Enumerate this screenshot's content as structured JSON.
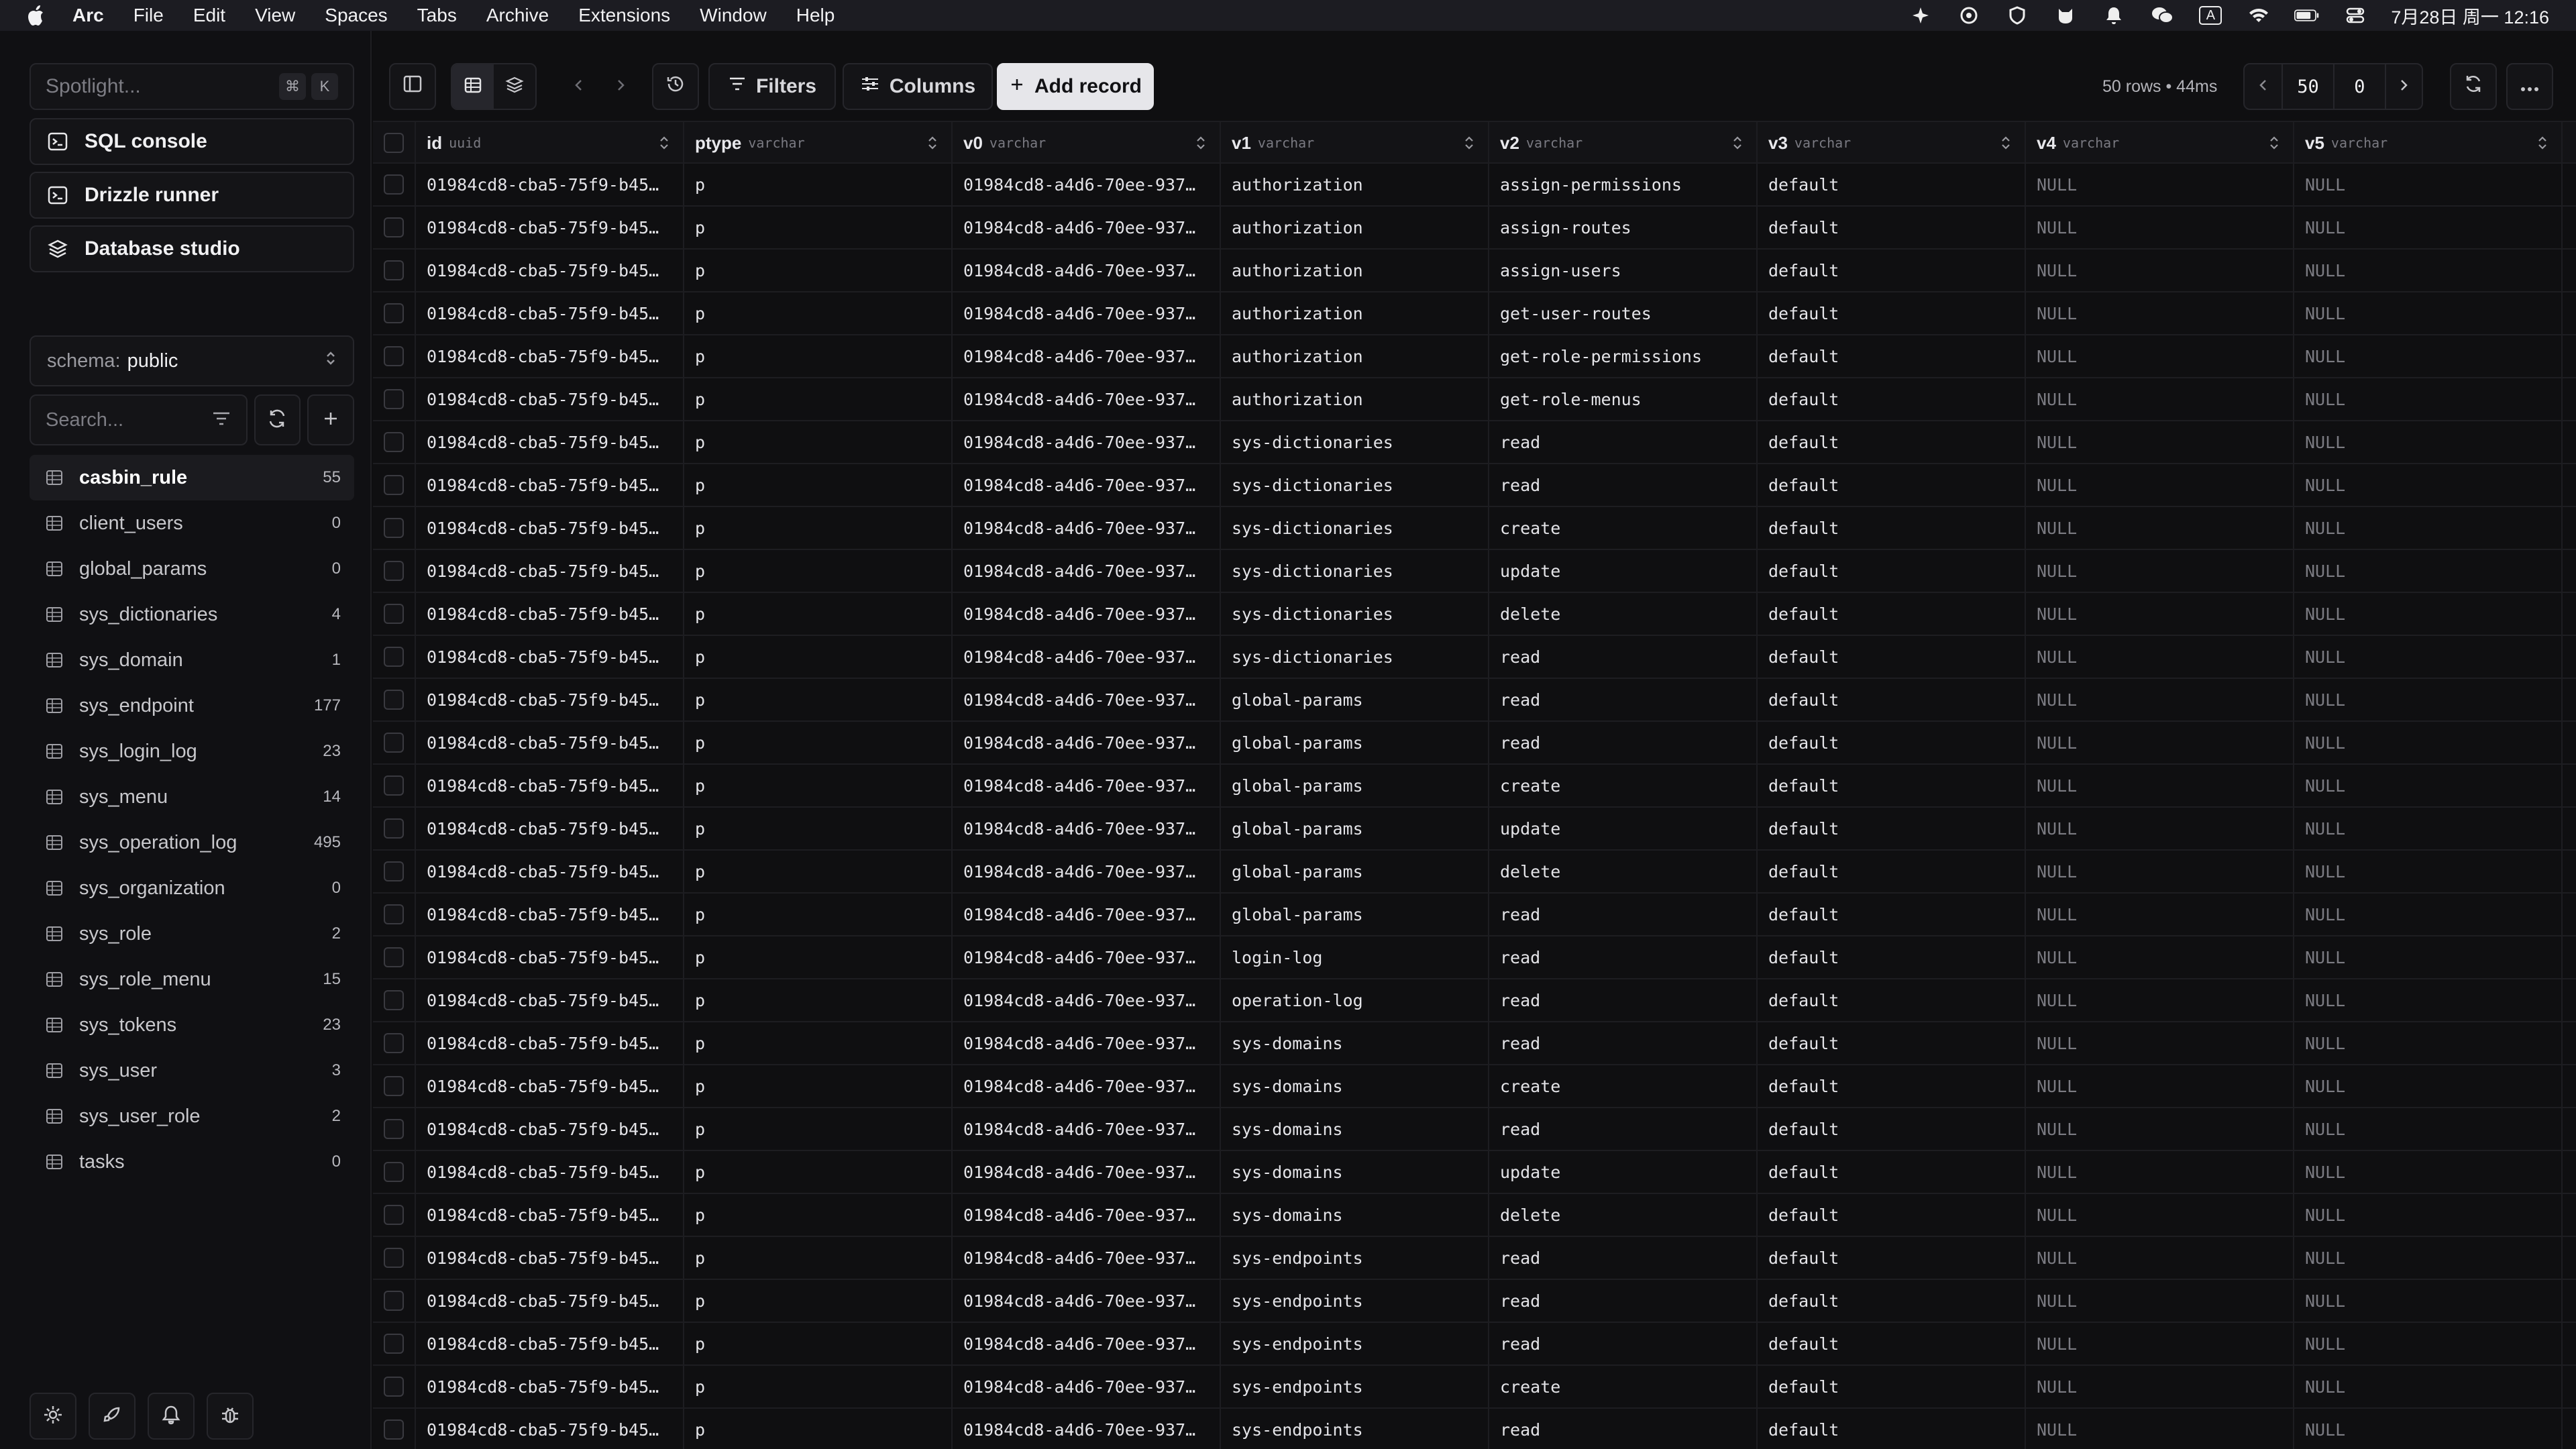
{
  "menubar": {
    "app": "Arc",
    "items": [
      "File",
      "Edit",
      "View",
      "Spaces",
      "Tabs",
      "Archive",
      "Extensions",
      "Window",
      "Help"
    ],
    "clock": "7月28日 周一 12:16",
    "input_indicator": "A"
  },
  "sidebar": {
    "spotlight_placeholder": "Spotlight...",
    "shortcut_cmd": "⌘",
    "shortcut_key": "K",
    "nav": [
      {
        "label": "SQL console",
        "icon": "terminal-icon"
      },
      {
        "label": "Drizzle runner",
        "icon": "terminal-icon"
      },
      {
        "label": "Database studio",
        "icon": "layers-icon"
      }
    ],
    "schema_label": "schema:",
    "schema_value": "public",
    "search_placeholder": "Search...",
    "tables": [
      {
        "name": "casbin_rule",
        "count": "55",
        "active": true
      },
      {
        "name": "client_users",
        "count": "0"
      },
      {
        "name": "global_params",
        "count": "0"
      },
      {
        "name": "sys_dictionaries",
        "count": "4"
      },
      {
        "name": "sys_domain",
        "count": "1"
      },
      {
        "name": "sys_endpoint",
        "count": "177"
      },
      {
        "name": "sys_login_log",
        "count": "23"
      },
      {
        "name": "sys_menu",
        "count": "14"
      },
      {
        "name": "sys_operation_log",
        "count": "495"
      },
      {
        "name": "sys_organization",
        "count": "0"
      },
      {
        "name": "sys_role",
        "count": "2"
      },
      {
        "name": "sys_role_menu",
        "count": "15"
      },
      {
        "name": "sys_tokens",
        "count": "23"
      },
      {
        "name": "sys_user",
        "count": "3"
      },
      {
        "name": "sys_user_role",
        "count": "2"
      },
      {
        "name": "tasks",
        "count": "0"
      }
    ]
  },
  "toolbar": {
    "filters_label": "Filters",
    "columns_label": "Columns",
    "add_record_label": "Add record",
    "rows_info": "50 rows • 44ms",
    "limit": "50",
    "offset": "0"
  },
  "grid": {
    "columns": [
      {
        "name": "id",
        "type": "uuid"
      },
      {
        "name": "ptype",
        "type": "varchar"
      },
      {
        "name": "v0",
        "type": "varchar"
      },
      {
        "name": "v1",
        "type": "varchar"
      },
      {
        "name": "v2",
        "type": "varchar"
      },
      {
        "name": "v3",
        "type": "varchar"
      },
      {
        "name": "v4",
        "type": "varchar"
      },
      {
        "name": "v5",
        "type": "varchar"
      }
    ],
    "id_value": "01984cd8-cba5-75f9-b45…",
    "ptype_value": "p",
    "v0_value": "01984cd8-a4d6-70ee-937…",
    "v3_value": "default",
    "null_value": "NULL",
    "rows": [
      [
        "authorization",
        "assign-permissions"
      ],
      [
        "authorization",
        "assign-routes"
      ],
      [
        "authorization",
        "assign-users"
      ],
      [
        "authorization",
        "get-user-routes"
      ],
      [
        "authorization",
        "get-role-permissions"
      ],
      [
        "authorization",
        "get-role-menus"
      ],
      [
        "sys-dictionaries",
        "read"
      ],
      [
        "sys-dictionaries",
        "read"
      ],
      [
        "sys-dictionaries",
        "create"
      ],
      [
        "sys-dictionaries",
        "update"
      ],
      [
        "sys-dictionaries",
        "delete"
      ],
      [
        "sys-dictionaries",
        "read"
      ],
      [
        "global-params",
        "read"
      ],
      [
        "global-params",
        "read"
      ],
      [
        "global-params",
        "create"
      ],
      [
        "global-params",
        "update"
      ],
      [
        "global-params",
        "delete"
      ],
      [
        "global-params",
        "read"
      ],
      [
        "login-log",
        "read"
      ],
      [
        "operation-log",
        "read"
      ],
      [
        "sys-domains",
        "read"
      ],
      [
        "sys-domains",
        "create"
      ],
      [
        "sys-domains",
        "read"
      ],
      [
        "sys-domains",
        "update"
      ],
      [
        "sys-domains",
        "delete"
      ],
      [
        "sys-endpoints",
        "read"
      ],
      [
        "sys-endpoints",
        "read"
      ],
      [
        "sys-endpoints",
        "read"
      ],
      [
        "sys-endpoints",
        "create"
      ],
      [
        "sys-endpoints",
        "read"
      ]
    ]
  }
}
